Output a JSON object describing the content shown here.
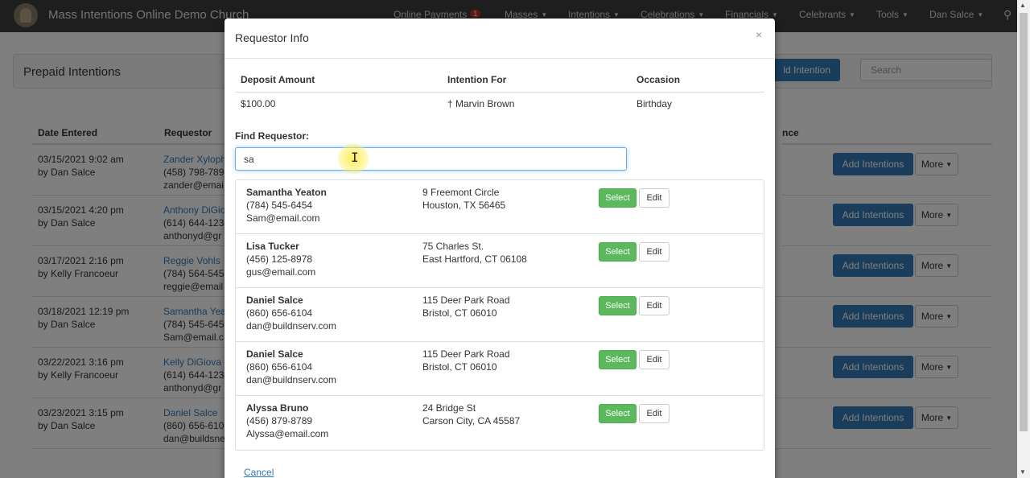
{
  "navbar": {
    "brand": "Mass Intentions Online Demo Church",
    "items": [
      {
        "label": "Online Payments",
        "badge": "1"
      },
      {
        "label": "Masses"
      },
      {
        "label": "Intentions"
      },
      {
        "label": "Celebrations"
      },
      {
        "label": "Financials"
      },
      {
        "label": "Celebrants"
      },
      {
        "label": "Tools"
      },
      {
        "label": "Dan Salce"
      }
    ],
    "search_icon": "magnifier-icon"
  },
  "page": {
    "heading": "Prepaid Intentions",
    "add_button": "ld Intention",
    "search_placeholder": "Search",
    "columns": {
      "date": "Date Entered",
      "requestor": "Requestor",
      "balance": "nce"
    },
    "rows": [
      {
        "date": "03/15/2021 9:02 am",
        "by": "by Dan Salce",
        "name": "Zander Xyloph",
        "phone": "(458) 798-789",
        "email": "zander@emai"
      },
      {
        "date": "03/15/2021 4:20 pm",
        "by": "by Dan Salce",
        "name": "Anthony DiGio",
        "phone": "(614) 644-123",
        "email": "anthonyd@gr"
      },
      {
        "date": "03/17/2021 2:16 pm",
        "by": "by Kelly Francoeur",
        "name": "Reggie Vohls",
        "phone": "(784) 564-545",
        "email": "reggie@email"
      },
      {
        "date": "03/18/2021 12:19 pm",
        "by": "by Dan Salce",
        "name": "Samantha Yea",
        "phone": "(784) 545-645",
        "email": "Sam@email.c"
      },
      {
        "date": "03/22/2021 3:16 pm",
        "by": "by Kelly Francoeur",
        "name": "Kelly DiGiova",
        "phone": "(614) 644-123",
        "email": "anthonyd@gr"
      },
      {
        "date": "03/23/2021 3:15 pm",
        "by": "by Dan Salce",
        "name": "Daniel Salce",
        "phone": "(860) 656-610",
        "email": "dan@buildsne"
      }
    ],
    "row_add_label": "Add Intentions",
    "row_more_label": "More"
  },
  "modal": {
    "title": "Requestor Info",
    "close_symbol": "×",
    "info_headers": {
      "deposit": "Deposit Amount",
      "intention_for": "Intention For",
      "occasion": "Occasion"
    },
    "info_values": {
      "deposit": "$100.00",
      "intention_for": "† Marvin Brown",
      "occasion": "Birthday"
    },
    "find_label": "Find Requestor:",
    "find_value": "sa",
    "results": [
      {
        "name": "Samantha Yeaton",
        "phone": "(784) 545-6454",
        "email": "Sam@email.com",
        "addr1": "9 Freemont Circle",
        "addr2": "Houston, TX 56465"
      },
      {
        "name": "Lisa Tucker",
        "phone": "(456) 125-8978",
        "email": "gus@email.com",
        "addr1": "75 Charles St.",
        "addr2": "East Hartford, CT 06108"
      },
      {
        "name": "Daniel Salce",
        "phone": "(860) 656-6104",
        "email": "dan@buildnserv.com",
        "addr1": "115 Deer Park Road",
        "addr2": "Bristol, CT 06010"
      },
      {
        "name": "Daniel Salce",
        "phone": "(860) 656-6104",
        "email": "dan@buildnserv.com",
        "addr1": "115 Deer Park Road",
        "addr2": "Bristol, CT 06010"
      },
      {
        "name": "Alyssa Bruno",
        "phone": "(456) 879-8789",
        "email": "Alyssa@email.com",
        "addr1": "24 Bridge St",
        "addr2": "Carson City, CA 45587"
      }
    ],
    "select_label": "Select",
    "edit_label": "Edit",
    "cancel_label": "Cancel"
  }
}
